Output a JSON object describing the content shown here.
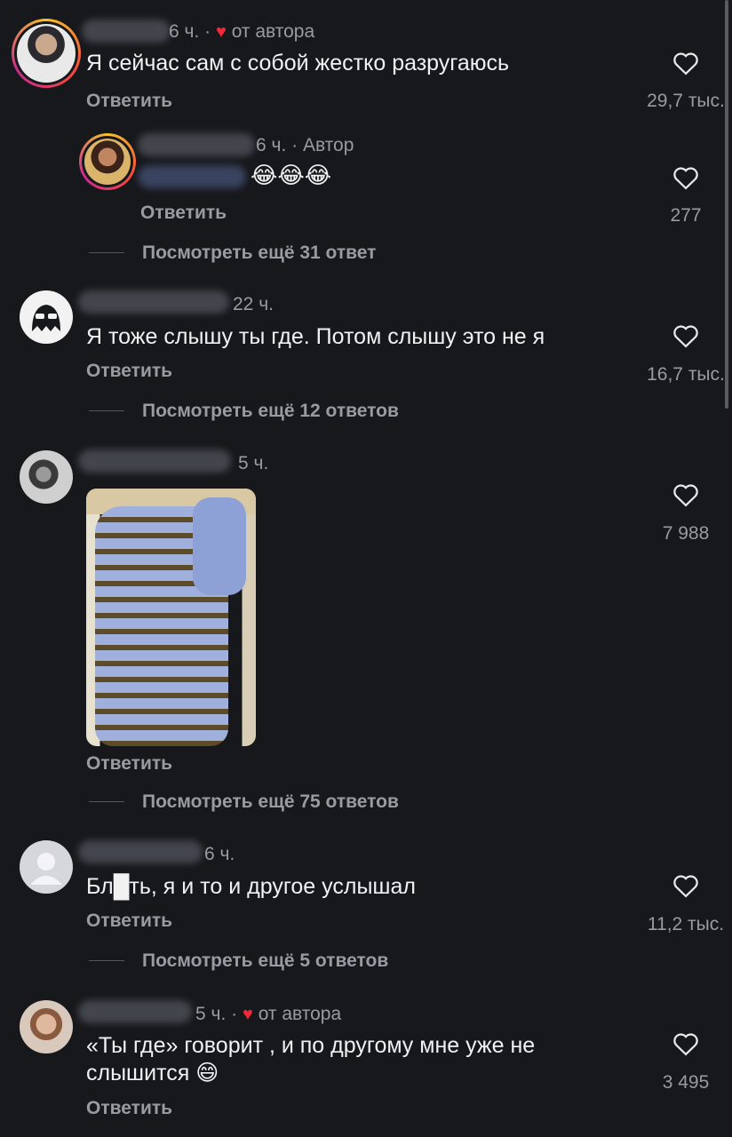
{
  "comments": [
    {
      "time": "6 ч. ·",
      "author_badge": "от автора",
      "text": "Я сейчас сам с собой жестко разругаюсь",
      "reply": "Ответить",
      "likes": "29,7 тыс."
    },
    {
      "time": "6 ч. ·",
      "author_badge": "Автор",
      "text": "😂😂😂",
      "reply": "Ответить",
      "likes": "277",
      "more": "Посмотреть ещё 31 ответ"
    },
    {
      "time": "22 ч.",
      "text": "Я тоже слышу ты где. Потом слышу это не я",
      "reply": "Ответить",
      "likes": "16,7 тыс.",
      "more": "Посмотреть ещё 12 ответов"
    },
    {
      "time": "5 ч.",
      "reply": "Ответить",
      "likes": "7 988",
      "more": "Посмотреть ещё 75 ответов"
    },
    {
      "time": "6 ч.",
      "text": "Бл█ть, я и то и другое услышал",
      "reply": "Ответить",
      "likes": "11,2 тыс.",
      "more": "Посмотреть ещё 5 ответов"
    },
    {
      "time": "5 ч. ·",
      "author_badge": "от автора",
      "text_line1": "«Ты где» говорит , и по другому мне уже не",
      "text_line2": "слышится 😄",
      "reply": "Ответить",
      "likes": "3 495"
    }
  ],
  "colors": {
    "background": "#17181c",
    "muted": "#9a9ba2",
    "heart": "#f02838"
  }
}
